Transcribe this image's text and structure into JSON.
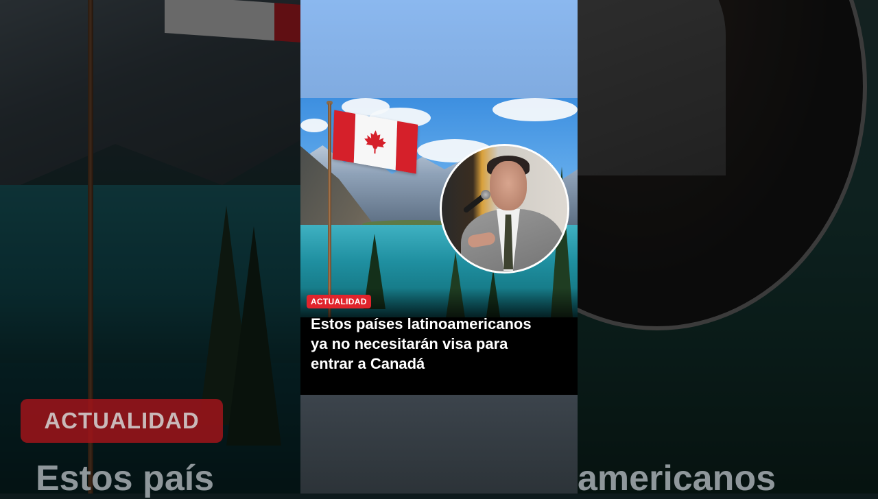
{
  "video": {
    "category_badge": "ACTUALIDAD",
    "headline_lines": [
      "Estos países latinoamericanos",
      "ya no necesitarán visa para",
      "entrar a Canadá"
    ]
  },
  "background": {
    "badge": "ACTUALIDAD",
    "headline_left": "Estos país",
    "headline_right": "americanos"
  },
  "icons": {
    "flag": "canada-flag-icon",
    "maple_leaf": "maple-leaf-icon"
  },
  "colors": {
    "badge_red": "#e0242c",
    "flag_red": "#d5202a",
    "headline_text": "#ffffff"
  }
}
